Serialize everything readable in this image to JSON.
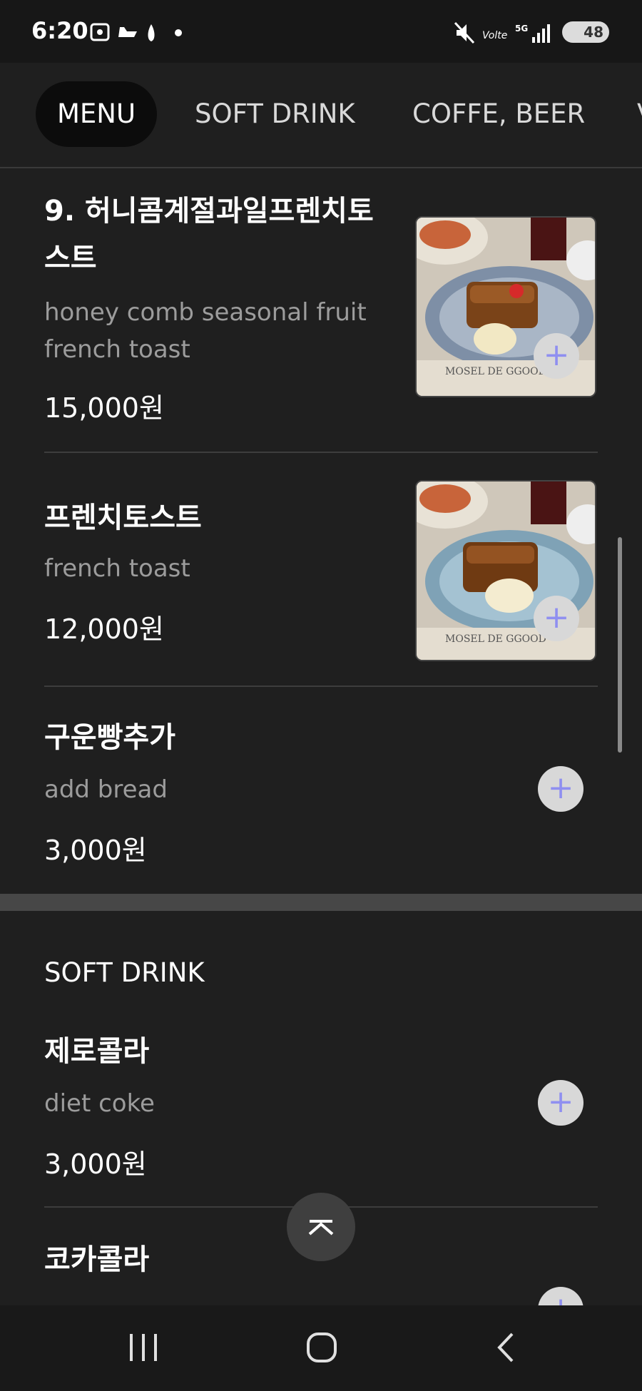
{
  "status": {
    "time": "6:20",
    "battery": "48"
  },
  "tabs": [
    {
      "label": "MENU"
    },
    {
      "label": "SOFT DRINK"
    },
    {
      "label": "COFFE, BEER"
    }
  ],
  "items": [
    {
      "title_line1": "9. 허니콤계절과일프렌치토",
      "title_line2": "스트",
      "desc_line1": "honey comb seasonal fruit",
      "desc_line2": "french toast",
      "price": "15,000원"
    },
    {
      "title": "프렌치토스트",
      "desc": "french toast",
      "price": "12,000원"
    },
    {
      "title": "구운빵추가",
      "desc": "add bread",
      "price": "3,000원"
    }
  ],
  "soft_drink": {
    "section_title": "SOFT DRINK",
    "items": [
      {
        "title": "제로콜라",
        "desc": "diet coke",
        "price": "3,000원"
      },
      {
        "title": "코카콜라"
      }
    ]
  },
  "colors": {
    "background": "#1f1f1f",
    "add_icon": "#8f8ff0"
  }
}
